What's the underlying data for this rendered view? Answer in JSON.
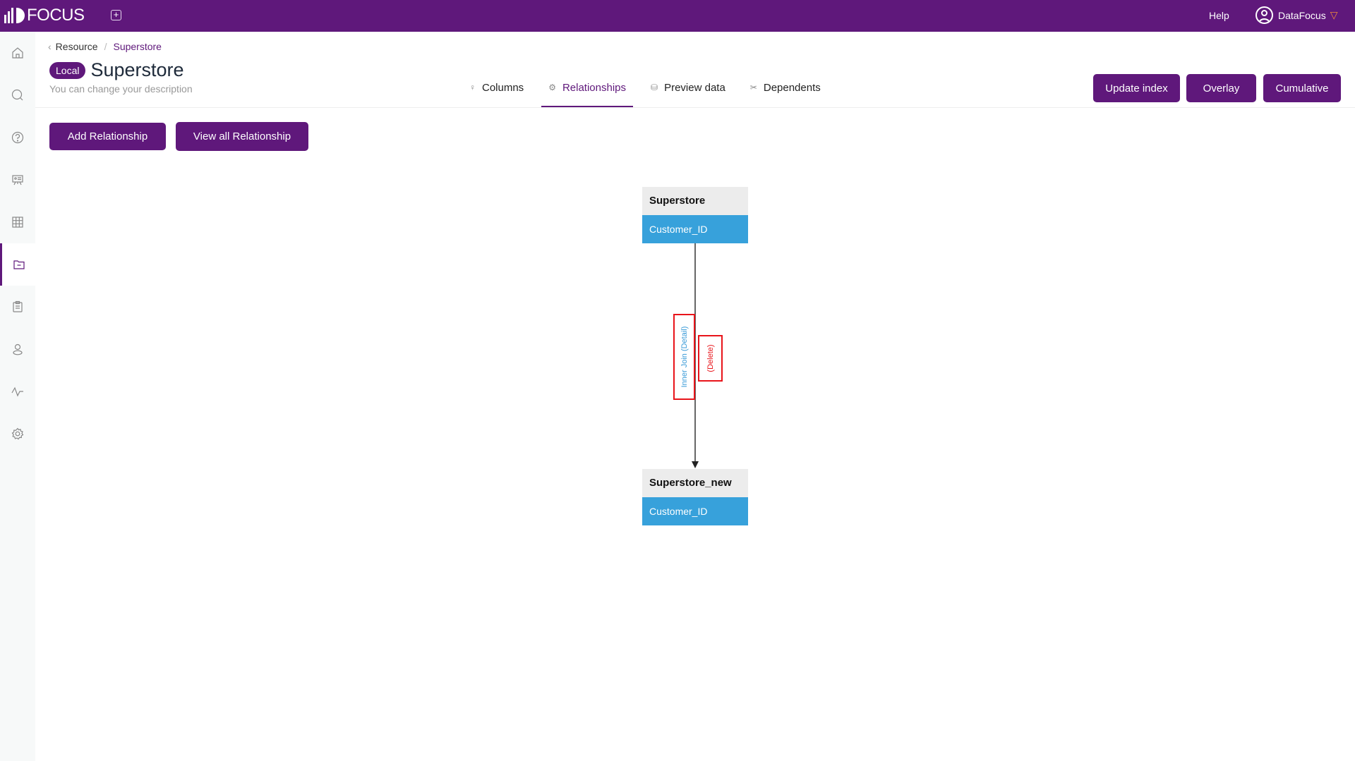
{
  "topbar": {
    "logo_text": "FOCUS",
    "new_tab_icon": "+",
    "help_label": "Help",
    "user_name": "DataFocus",
    "user_badge_icon": "▽"
  },
  "sidebar": {
    "items": [
      {
        "name": "home",
        "active": false
      },
      {
        "name": "search",
        "active": false
      },
      {
        "name": "help",
        "active": false
      },
      {
        "name": "presentation",
        "active": false
      },
      {
        "name": "table",
        "active": false
      },
      {
        "name": "folder",
        "active": true
      },
      {
        "name": "clipboard",
        "active": false
      },
      {
        "name": "user",
        "active": false
      },
      {
        "name": "monitor",
        "active": false
      },
      {
        "name": "settings",
        "active": false
      }
    ]
  },
  "breadcrumb": {
    "back_icon": "‹",
    "parent": "Resource",
    "separator": "/",
    "current": "Superstore"
  },
  "page": {
    "badge": "Local",
    "title": "Superstore",
    "description_placeholder": "You can change your description"
  },
  "tabs": [
    {
      "label": "Columns",
      "icon": "♀",
      "active": false
    },
    {
      "label": "Relationships",
      "icon": "⚙",
      "active": true
    },
    {
      "label": "Preview data",
      "icon": "⛁",
      "active": false
    },
    {
      "label": "Dependents",
      "icon": "✂",
      "active": false
    }
  ],
  "actions": {
    "update_index": "Update index",
    "overlay": "Overlay",
    "cumulative": "Cumulative"
  },
  "toolbar": {
    "add_relationship": "Add Relationship",
    "view_all_relationship": "View all Relationship"
  },
  "diagram": {
    "source_table": {
      "name": "Superstore",
      "column": "Customer_ID"
    },
    "target_table": {
      "name": "Superstore_new",
      "column": "Customer_ID"
    },
    "join_label": "Inner Join (Detail)",
    "delete_label": "(Delete)",
    "colors": {
      "join_text": "#3a9bd8",
      "delete_text": "#e8141a",
      "column_bg": "#37a1db",
      "header_bg": "#ececec"
    }
  },
  "theme": {
    "brand": "#5f187b"
  }
}
